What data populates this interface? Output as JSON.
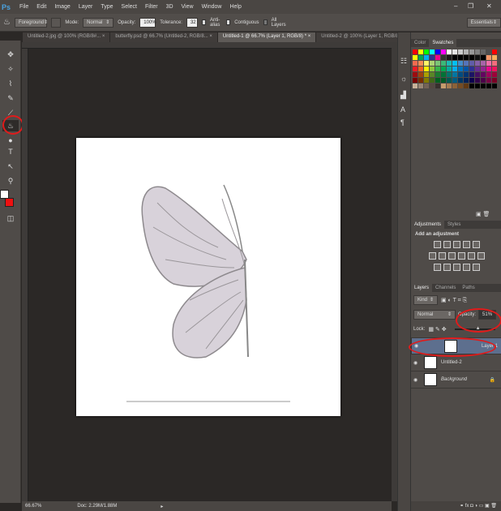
{
  "app": {
    "logo": "Ps"
  },
  "menu": [
    "File",
    "Edit",
    "Image",
    "Layer",
    "Type",
    "Select",
    "Filter",
    "3D",
    "View",
    "Window",
    "Help"
  ],
  "window_controls": {
    "minimize": "–",
    "restore": "❐",
    "close": "✕"
  },
  "options": {
    "fill_source": "Foreground",
    "mode_label": "Mode:",
    "mode": "Normal",
    "opacity_label": "Opacity:",
    "opacity": "100%",
    "tolerance_label": "Tolerance:",
    "tolerance": "32",
    "anti_alias": "Anti-alias",
    "contiguous": "Contiguous",
    "all_layers": "All Layers",
    "workspace": "Essentials"
  },
  "tabs": [
    {
      "label": "Untitled-2.jpg @ 100% (RGB/8#...",
      "close": "×"
    },
    {
      "label": "butterfly.psd @ 66.7% (Untitled-2, RGB/8...",
      "close": "×"
    },
    {
      "label": "Untitled-1 @ 66.7% (Layer 1, RGB/8) *",
      "close": "×"
    },
    {
      "label": "Untitled-2 @ 100% (Layer 1, RGB/8...",
      "close": "×"
    }
  ],
  "status": {
    "zoom": "66.67%",
    "doc": "Doc: 2.29M/1.88M"
  },
  "panels": {
    "color_tabs": [
      "Color",
      "Swatches"
    ],
    "adjust_tabs": [
      "Adjustments",
      "Styles"
    ],
    "adjust_title": "Add an adjustment",
    "layer_tabs": [
      "Layers",
      "Channels",
      "Paths"
    ],
    "kind": "Kind",
    "blend": "Normal",
    "opacity_label": "Opacity:",
    "opacity": "51%",
    "lock_label": "Lock:",
    "layers": [
      {
        "name": "Layer 1",
        "selected": true
      },
      {
        "name": "Untitled-2",
        "selected": false
      },
      {
        "name": "Background",
        "selected": false,
        "locked": true
      }
    ]
  },
  "swatch_colors": [
    "#ff0000",
    "#ffff00",
    "#00ff00",
    "#00ffff",
    "#0000ff",
    "#ff00ff",
    "#ffffff",
    "#e6e6e6",
    "#cccccc",
    "#b3b3b3",
    "#999999",
    "#808080",
    "#666666",
    "#4d4d4d",
    "#ff0000",
    "#ffff00",
    "#00a651",
    "#00aeef",
    "#2e3192",
    "#ec008c",
    "#333333",
    "#1a1a1a",
    "#000000",
    "#000000",
    "#000000",
    "#000000",
    "#111111",
    "#000000",
    "#f7976a",
    "#fbaf5d",
    "#f26c4f",
    "#f68e56",
    "#fff568",
    "#acd373",
    "#7cc576",
    "#3bb878",
    "#1abbb4",
    "#00bff3",
    "#438ccb",
    "#5574b9",
    "#605ca8",
    "#855fa8",
    "#a763a8",
    "#f06eaa",
    "#f26d7d",
    "#ed1c24",
    "#f26522",
    "#fff200",
    "#8dc63f",
    "#39b54a",
    "#00a651",
    "#00a99d",
    "#00aeef",
    "#0072bc",
    "#0054a6",
    "#2e3192",
    "#662d91",
    "#92278f",
    "#ec008c",
    "#ed145b",
    "#9e0b0f",
    "#a0410d",
    "#aba000",
    "#598527",
    "#1a7b30",
    "#007236",
    "#00746b",
    "#0076a3",
    "#004b80",
    "#003471",
    "#1b1464",
    "#440e62",
    "#630460",
    "#9e005d",
    "#9e0039",
    "#790000",
    "#7b2e00",
    "#827b00",
    "#406618",
    "#005e20",
    "#005826",
    "#005952",
    "#005b7f",
    "#003663",
    "#002157",
    "#0d004c",
    "#32004b",
    "#4b0049",
    "#7b0046",
    "#7a0026",
    "#c7b299",
    "#998675",
    "#736357",
    "#534741",
    "#37302d",
    "#c69c6d",
    "#a67c52",
    "#8c6239",
    "#754c24",
    "#603913",
    "#000000",
    "#000000",
    "#000000",
    "#000000",
    "#000000"
  ]
}
